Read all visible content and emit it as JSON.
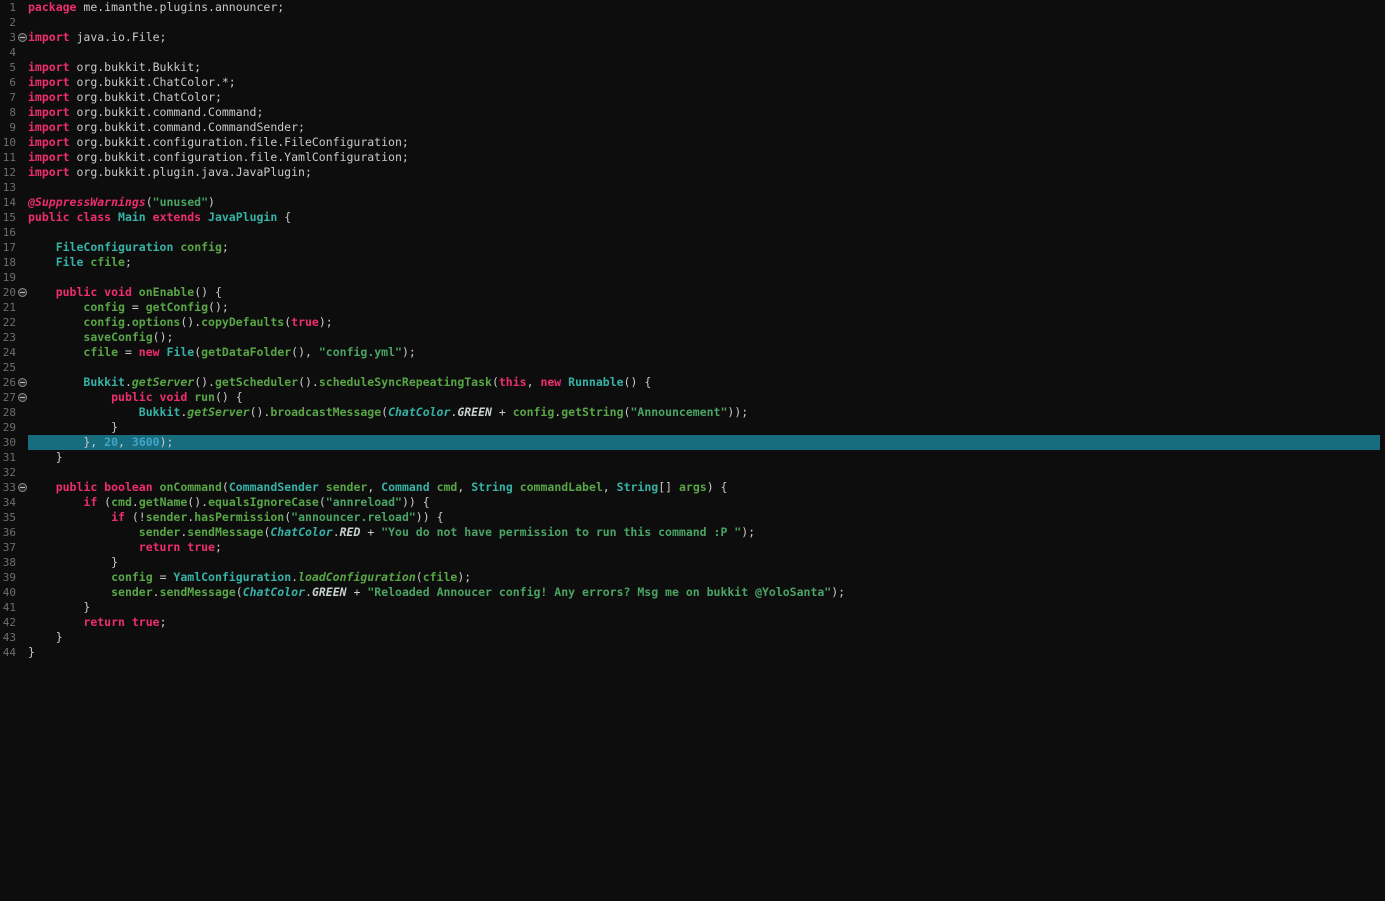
{
  "colors": {
    "background": "#0d0d0d",
    "gutter_text": "#6e6e6e",
    "plain": "#c9c9c9",
    "keyword": "#ee2d6e",
    "type": "#36b2a7",
    "method": "#58a646",
    "string": "#4aa463",
    "number": "#42a4c6",
    "annotation": "#ee2d6e",
    "constant": "#c9d2cf",
    "highlight_line": "#176d7d"
  },
  "editor": {
    "language": "java",
    "highlighted_line": 30,
    "fold_lines": [
      3,
      20,
      26,
      27,
      33
    ],
    "lines": [
      {
        "n": 1,
        "tokens": [
          [
            "kw",
            "package"
          ],
          [
            "pl",
            " me.imanthe.plugins.announcer;"
          ]
        ]
      },
      {
        "n": 2,
        "tokens": []
      },
      {
        "n": 3,
        "tokens": [
          [
            "kw",
            "import"
          ],
          [
            "pl",
            " java.io.File;"
          ]
        ]
      },
      {
        "n": 4,
        "tokens": []
      },
      {
        "n": 5,
        "tokens": [
          [
            "kw",
            "import"
          ],
          [
            "pl",
            " org.bukkit.Bukkit;"
          ]
        ]
      },
      {
        "n": 6,
        "tokens": [
          [
            "kw",
            "import"
          ],
          [
            "pl",
            " org.bukkit.ChatColor.*;"
          ]
        ]
      },
      {
        "n": 7,
        "tokens": [
          [
            "kw",
            "import"
          ],
          [
            "pl",
            " org.bukkit.ChatColor;"
          ]
        ]
      },
      {
        "n": 8,
        "tokens": [
          [
            "kw",
            "import"
          ],
          [
            "pl",
            " org.bukkit.command.Command;"
          ]
        ]
      },
      {
        "n": 9,
        "tokens": [
          [
            "kw",
            "import"
          ],
          [
            "pl",
            " org.bukkit.command.CommandSender;"
          ]
        ]
      },
      {
        "n": 10,
        "tokens": [
          [
            "kw",
            "import"
          ],
          [
            "pl",
            " org.bukkit.configuration.file.FileConfiguration;"
          ]
        ]
      },
      {
        "n": 11,
        "tokens": [
          [
            "kw",
            "import"
          ],
          [
            "pl",
            " org.bukkit.configuration.file.YamlConfiguration;"
          ]
        ]
      },
      {
        "n": 12,
        "tokens": [
          [
            "kw",
            "import"
          ],
          [
            "pl",
            " org.bukkit.plugin.java.JavaPlugin;"
          ]
        ]
      },
      {
        "n": 13,
        "tokens": []
      },
      {
        "n": 14,
        "tokens": [
          [
            "ann",
            "@SuppressWarnings"
          ],
          [
            "pl",
            "("
          ],
          [
            "str",
            "\"unused\""
          ],
          [
            "pl",
            ")"
          ]
        ]
      },
      {
        "n": 15,
        "tokens": [
          [
            "kw",
            "public class "
          ],
          [
            "ty",
            "Main"
          ],
          [
            "kw",
            " extends "
          ],
          [
            "ty",
            "JavaPlugin"
          ],
          [
            "pl",
            " {"
          ]
        ]
      },
      {
        "n": 16,
        "tokens": []
      },
      {
        "n": 17,
        "tokens": [
          [
            "pl",
            "    "
          ],
          [
            "ty",
            "FileConfiguration"
          ],
          [
            "pl",
            " "
          ],
          [
            "fld",
            "config"
          ],
          [
            "pl",
            ";"
          ]
        ]
      },
      {
        "n": 18,
        "tokens": [
          [
            "pl",
            "    "
          ],
          [
            "ty",
            "File"
          ],
          [
            "pl",
            " "
          ],
          [
            "fld",
            "cfile"
          ],
          [
            "pl",
            ";"
          ]
        ]
      },
      {
        "n": 19,
        "tokens": []
      },
      {
        "n": 20,
        "tokens": [
          [
            "pl",
            "    "
          ],
          [
            "kw",
            "public void "
          ],
          [
            "fn",
            "onEnable"
          ],
          [
            "pl",
            "() {"
          ]
        ]
      },
      {
        "n": 21,
        "tokens": [
          [
            "pl",
            "        "
          ],
          [
            "fld",
            "config"
          ],
          [
            "pl",
            " = "
          ],
          [
            "fn",
            "getConfig"
          ],
          [
            "pl",
            "();"
          ]
        ]
      },
      {
        "n": 22,
        "tokens": [
          [
            "pl",
            "        "
          ],
          [
            "fld",
            "config"
          ],
          [
            "pl",
            "."
          ],
          [
            "fn",
            "options"
          ],
          [
            "pl",
            "()."
          ],
          [
            "fn",
            "copyDefaults"
          ],
          [
            "pl",
            "("
          ],
          [
            "kw",
            "true"
          ],
          [
            "pl",
            ");"
          ]
        ]
      },
      {
        "n": 23,
        "tokens": [
          [
            "pl",
            "        "
          ],
          [
            "fn",
            "saveConfig"
          ],
          [
            "pl",
            "();"
          ]
        ]
      },
      {
        "n": 24,
        "tokens": [
          [
            "pl",
            "        "
          ],
          [
            "fld",
            "cfile"
          ],
          [
            "pl",
            " = "
          ],
          [
            "kw",
            "new"
          ],
          [
            "pl",
            " "
          ],
          [
            "ty",
            "File"
          ],
          [
            "pl",
            "("
          ],
          [
            "fn",
            "getDataFolder"
          ],
          [
            "pl",
            "(), "
          ],
          [
            "str",
            "\"config.yml\""
          ],
          [
            "pl",
            ");"
          ]
        ]
      },
      {
        "n": 25,
        "tokens": []
      },
      {
        "n": 26,
        "tokens": [
          [
            "pl",
            "        "
          ],
          [
            "ty",
            "Bukkit"
          ],
          [
            "pl",
            "."
          ],
          [
            "fni",
            "getServer"
          ],
          [
            "pl",
            "()."
          ],
          [
            "fn",
            "getScheduler"
          ],
          [
            "pl",
            "()."
          ],
          [
            "fn",
            "scheduleSyncRepeatingTask"
          ],
          [
            "pl",
            "("
          ],
          [
            "kw",
            "this"
          ],
          [
            "pl",
            ", "
          ],
          [
            "kw",
            "new"
          ],
          [
            "pl",
            " "
          ],
          [
            "ty",
            "Runnable"
          ],
          [
            "pl",
            "() {"
          ]
        ]
      },
      {
        "n": 27,
        "tokens": [
          [
            "pl",
            "            "
          ],
          [
            "kw",
            "public void "
          ],
          [
            "fn",
            "run"
          ],
          [
            "pl",
            "() {"
          ]
        ]
      },
      {
        "n": 28,
        "tokens": [
          [
            "pl",
            "                "
          ],
          [
            "ty",
            "Bukkit"
          ],
          [
            "pl",
            "."
          ],
          [
            "fni",
            "getServer"
          ],
          [
            "pl",
            "()."
          ],
          [
            "fn",
            "broadcastMessage"
          ],
          [
            "pl",
            "("
          ],
          [
            "tyi",
            "ChatColor"
          ],
          [
            "pl",
            "."
          ],
          [
            "cst",
            "GREEN"
          ],
          [
            "pl",
            " + "
          ],
          [
            "fld",
            "config"
          ],
          [
            "pl",
            "."
          ],
          [
            "fn",
            "getString"
          ],
          [
            "pl",
            "("
          ],
          [
            "str",
            "\"Announcement\""
          ],
          [
            "pl",
            "));"
          ]
        ]
      },
      {
        "n": 29,
        "tokens": [
          [
            "pl",
            "            }"
          ]
        ]
      },
      {
        "n": 30,
        "tokens": [
          [
            "pl",
            "        }, "
          ],
          [
            "num",
            "20"
          ],
          [
            "pl",
            ", "
          ],
          [
            "num",
            "3600"
          ],
          [
            "pl",
            ");"
          ]
        ]
      },
      {
        "n": 31,
        "tokens": [
          [
            "pl",
            "    }"
          ]
        ]
      },
      {
        "n": 32,
        "tokens": []
      },
      {
        "n": 33,
        "tokens": [
          [
            "pl",
            "    "
          ],
          [
            "kw",
            "public boolean "
          ],
          [
            "fn",
            "onCommand"
          ],
          [
            "pl",
            "("
          ],
          [
            "ty",
            "CommandSender"
          ],
          [
            "pl",
            " "
          ],
          [
            "fld",
            "sender"
          ],
          [
            "pl",
            ", "
          ],
          [
            "ty",
            "Command"
          ],
          [
            "pl",
            " "
          ],
          [
            "fld",
            "cmd"
          ],
          [
            "pl",
            ", "
          ],
          [
            "ty",
            "String"
          ],
          [
            "pl",
            " "
          ],
          [
            "fld",
            "commandLabel"
          ],
          [
            "pl",
            ", "
          ],
          [
            "ty",
            "String"
          ],
          [
            "pl",
            "[] "
          ],
          [
            "fld",
            "args"
          ],
          [
            "pl",
            ") {"
          ]
        ]
      },
      {
        "n": 34,
        "tokens": [
          [
            "pl",
            "        "
          ],
          [
            "kw",
            "if"
          ],
          [
            "pl",
            " ("
          ],
          [
            "fld",
            "cmd"
          ],
          [
            "pl",
            "."
          ],
          [
            "fn",
            "getName"
          ],
          [
            "pl",
            "()."
          ],
          [
            "fn",
            "equalsIgnoreCase"
          ],
          [
            "pl",
            "("
          ],
          [
            "str",
            "\"annreload\""
          ],
          [
            "pl",
            ")) {"
          ]
        ]
      },
      {
        "n": 35,
        "tokens": [
          [
            "pl",
            "            "
          ],
          [
            "kw",
            "if"
          ],
          [
            "pl",
            " (!"
          ],
          [
            "fld",
            "sender"
          ],
          [
            "pl",
            "."
          ],
          [
            "fn",
            "hasPermission"
          ],
          [
            "pl",
            "("
          ],
          [
            "str",
            "\"announcer.reload\""
          ],
          [
            "pl",
            ")) {"
          ]
        ]
      },
      {
        "n": 36,
        "tokens": [
          [
            "pl",
            "                "
          ],
          [
            "fld",
            "sender"
          ],
          [
            "pl",
            "."
          ],
          [
            "fn",
            "sendMessage"
          ],
          [
            "pl",
            "("
          ],
          [
            "tyi",
            "ChatColor"
          ],
          [
            "pl",
            "."
          ],
          [
            "cst",
            "RED"
          ],
          [
            "pl",
            " + "
          ],
          [
            "str",
            "\"You do not have permission to run this command :P \""
          ],
          [
            "pl",
            ");"
          ]
        ]
      },
      {
        "n": 37,
        "tokens": [
          [
            "pl",
            "                "
          ],
          [
            "kw",
            "return"
          ],
          [
            "pl",
            " "
          ],
          [
            "kw",
            "true"
          ],
          [
            "pl",
            ";"
          ]
        ]
      },
      {
        "n": 38,
        "tokens": [
          [
            "pl",
            "            }"
          ]
        ]
      },
      {
        "n": 39,
        "tokens": [
          [
            "pl",
            "            "
          ],
          [
            "fld",
            "config"
          ],
          [
            "pl",
            " = "
          ],
          [
            "ty",
            "YamlConfiguration"
          ],
          [
            "pl",
            "."
          ],
          [
            "fni",
            "loadConfiguration"
          ],
          [
            "pl",
            "("
          ],
          [
            "fld",
            "cfile"
          ],
          [
            "pl",
            ");"
          ]
        ]
      },
      {
        "n": 40,
        "tokens": [
          [
            "pl",
            "            "
          ],
          [
            "fld",
            "sender"
          ],
          [
            "pl",
            "."
          ],
          [
            "fn",
            "sendMessage"
          ],
          [
            "pl",
            "("
          ],
          [
            "tyi",
            "ChatColor"
          ],
          [
            "pl",
            "."
          ],
          [
            "cst",
            "GREEN"
          ],
          [
            "pl",
            " + "
          ],
          [
            "str",
            "\"Reloaded Annoucer config! Any errors? Msg me on bukkit @YoloSanta\""
          ],
          [
            "pl",
            ");"
          ]
        ]
      },
      {
        "n": 41,
        "tokens": [
          [
            "pl",
            "        }"
          ]
        ]
      },
      {
        "n": 42,
        "tokens": [
          [
            "pl",
            "        "
          ],
          [
            "kw",
            "return"
          ],
          [
            "pl",
            " "
          ],
          [
            "kw",
            "true"
          ],
          [
            "pl",
            ";"
          ]
        ]
      },
      {
        "n": 43,
        "tokens": [
          [
            "pl",
            "    }"
          ]
        ]
      },
      {
        "n": 44,
        "tokens": [
          [
            "pl",
            "}"
          ]
        ]
      }
    ]
  }
}
